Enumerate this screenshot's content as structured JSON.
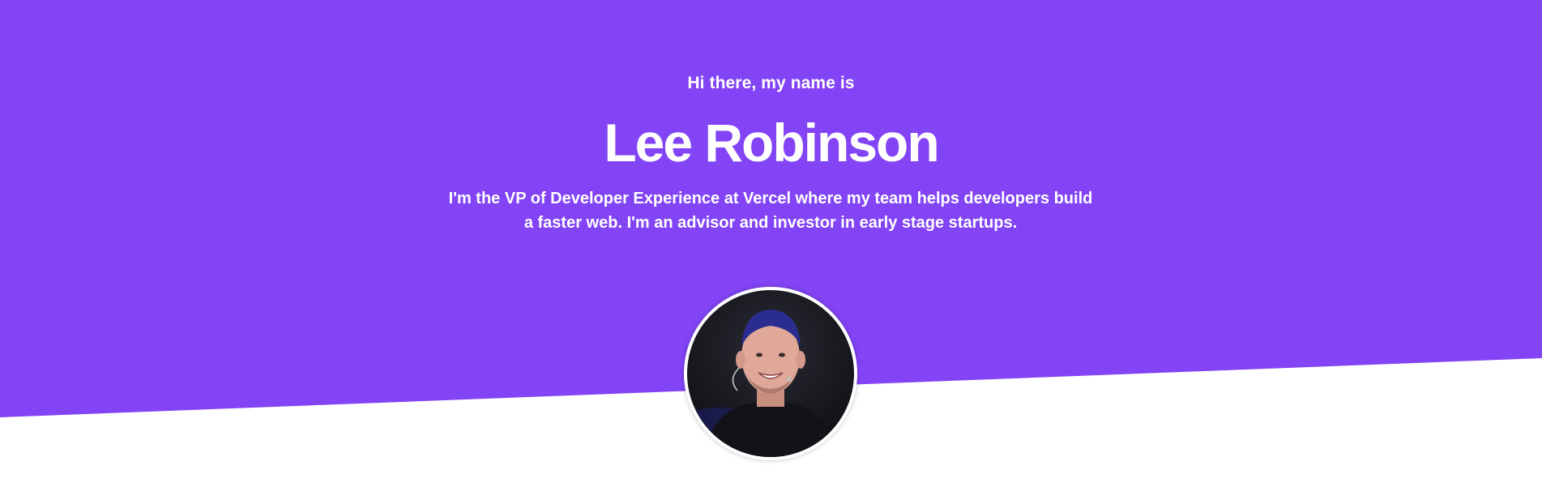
{
  "hero": {
    "greeting": "Hi there, my name is",
    "name": "Lee Robinson",
    "bio": "I'm the VP of Developer Experience at Vercel where my team helps developers build a faster web. I'm an advisor and investor in early stage startups."
  },
  "colors": {
    "accent": "#8244f5",
    "background": "#ffffff",
    "text_on_accent": "#ffffff"
  },
  "avatar": {
    "alt": "Lee Robinson"
  }
}
